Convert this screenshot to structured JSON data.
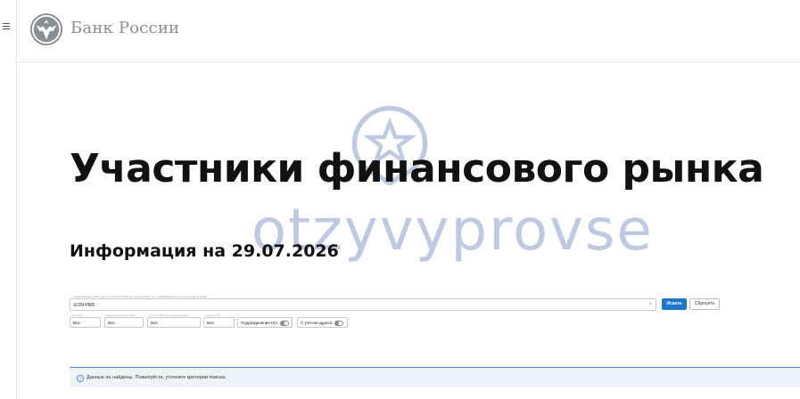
{
  "header": {
    "bank_name": "Банк России"
  },
  "watermark": {
    "text": "otzyvyprovse"
  },
  "main": {
    "title": "Участники финансового рынка",
    "info_date": "Информация на 29.07.2026"
  },
  "search": {
    "label": "Наименование, ИНН, адрес, ОГРН или ИНН для юридических лиц, наименования, регистрационный номер",
    "value": "EON PMD",
    "clear_symbol": "×",
    "search_button": "Искать",
    "reset_button": "Сбросить"
  },
  "filters": [
    {
      "label": "Тип НФО",
      "value": "Все"
    },
    {
      "label": "Вид деятельности НФО",
      "value": "Все"
    },
    {
      "label": "Статус НФО (регистрационный)",
      "value": "Все"
    },
    {
      "label": "Субъект РФ",
      "value": "Все"
    }
  ],
  "toggles": [
    {
      "label": "Подразделения НО"
    },
    {
      "label": "С учетом адреса"
    }
  ],
  "notice": {
    "icon": "i",
    "text": "Данные не найдены. Пожалуйста, уточните критерии поиска."
  },
  "colors": {
    "accent": "#1a77c9",
    "notice_bg": "#eef3fa",
    "watermark": "#6e87be"
  }
}
